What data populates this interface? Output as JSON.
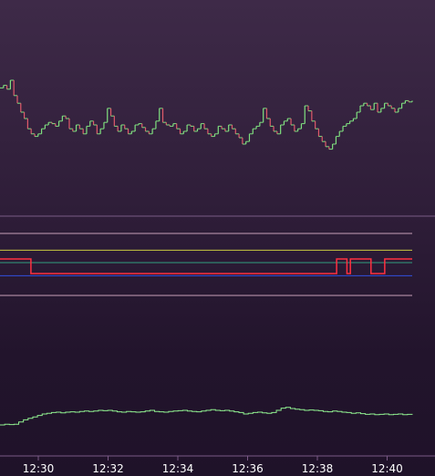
{
  "colors": {
    "up": "#7fe07f",
    "down": "#e05a6a",
    "neutral": "#c8b8d0",
    "signal": "#ff3040",
    "upper_band": "#c8c840",
    "middle_band": "#30a080",
    "lower_band": "#3050e0",
    "limit_lines": "#c8a0b8",
    "separator": "#7a5a86",
    "volume_line": "#90f090",
    "tick_text": "#ffffff"
  },
  "chart_data": [
    {
      "type": "line",
      "panel": "price",
      "title": "",
      "xlabel": "",
      "ylabel": "",
      "grid": false,
      "x_start": "12:29:20",
      "x_end": "12:40:35",
      "series": [
        {
          "values": [
            0.74,
            0.76,
            0.73,
            0.8,
            0.68,
            0.62,
            0.55,
            0.5,
            0.42,
            0.38,
            0.36,
            0.38,
            0.42,
            0.45,
            0.47,
            0.46,
            0.44,
            0.48,
            0.52,
            0.5,
            0.42,
            0.4,
            0.45,
            0.42,
            0.38,
            0.44,
            0.48,
            0.45,
            0.38,
            0.42,
            0.47,
            0.58,
            0.52,
            0.44,
            0.4,
            0.45,
            0.42,
            0.38,
            0.4,
            0.45,
            0.46,
            0.43,
            0.4,
            0.38,
            0.42,
            0.48,
            0.58,
            0.47,
            0.45,
            0.44,
            0.46,
            0.42,
            0.38,
            0.4,
            0.45,
            0.44,
            0.4,
            0.42,
            0.46,
            0.42,
            0.38,
            0.36,
            0.38,
            0.44,
            0.42,
            0.4,
            0.45,
            0.42,
            0.38,
            0.35,
            0.3,
            0.32,
            0.38,
            0.42,
            0.44,
            0.47,
            0.58,
            0.5,
            0.44,
            0.4,
            0.38,
            0.45,
            0.48,
            0.5,
            0.45,
            0.4,
            0.42,
            0.46,
            0.6,
            0.56,
            0.48,
            0.42,
            0.36,
            0.32,
            0.28,
            0.26,
            0.3,
            0.36,
            0.4,
            0.44,
            0.46,
            0.48,
            0.5,
            0.55,
            0.6,
            0.62,
            0.6,
            0.57,
            0.62,
            0.55,
            0.58,
            0.62,
            0.6,
            0.58,
            0.55,
            0.58,
            0.62,
            0.64,
            0.63,
            0.64
          ]
        }
      ]
    },
    {
      "type": "line",
      "panel": "indicator",
      "title": "",
      "grid": false,
      "ylim": [
        0,
        1
      ],
      "horizontal_levels": [
        {
          "role": "upper_limit",
          "value": 0.95
        },
        {
          "role": "upper_band",
          "value": 0.72
        },
        {
          "role": "middle_band",
          "value": 0.55
        },
        {
          "role": "lower_band",
          "value": 0.37
        },
        {
          "role": "lower_limit",
          "value": 0.1
        }
      ],
      "series": [
        {
          "values": [
            0.6,
            0.6,
            0.6,
            0.6,
            0.6,
            0.6,
            0.6,
            0.6,
            0.6,
            0.4,
            0.4,
            0.4,
            0.4,
            0.4,
            0.4,
            0.4,
            0.4,
            0.4,
            0.4,
            0.4,
            0.4,
            0.4,
            0.4,
            0.4,
            0.4,
            0.4,
            0.4,
            0.4,
            0.4,
            0.4,
            0.4,
            0.4,
            0.4,
            0.4,
            0.4,
            0.4,
            0.4,
            0.4,
            0.4,
            0.4,
            0.4,
            0.4,
            0.4,
            0.4,
            0.4,
            0.4,
            0.4,
            0.4,
            0.4,
            0.4,
            0.4,
            0.4,
            0.4,
            0.4,
            0.4,
            0.4,
            0.4,
            0.4,
            0.4,
            0.4,
            0.4,
            0.4,
            0.4,
            0.4,
            0.4,
            0.4,
            0.4,
            0.4,
            0.4,
            0.4,
            0.4,
            0.4,
            0.4,
            0.4,
            0.4,
            0.4,
            0.4,
            0.4,
            0.4,
            0.4,
            0.4,
            0.4,
            0.4,
            0.4,
            0.4,
            0.4,
            0.4,
            0.4,
            0.4,
            0.4,
            0.4,
            0.4,
            0.4,
            0.4,
            0.4,
            0.4,
            0.4,
            0.4,
            0.6,
            0.6,
            0.6,
            0.4,
            0.6,
            0.6,
            0.6,
            0.6,
            0.6,
            0.6,
            0.4,
            0.4,
            0.4,
            0.4,
            0.6,
            0.6,
            0.6,
            0.6,
            0.6,
            0.6,
            0.6,
            0.6,
            0.6
          ]
        }
      ]
    },
    {
      "type": "line",
      "panel": "volume",
      "title": "",
      "grid": false,
      "ylim": [
        0,
        1
      ],
      "series": [
        {
          "values": [
            0.1,
            0.12,
            0.11,
            0.12,
            0.18,
            0.24,
            0.28,
            0.32,
            0.36,
            0.4,
            0.42,
            0.44,
            0.45,
            0.43,
            0.45,
            0.46,
            0.45,
            0.47,
            0.48,
            0.47,
            0.48,
            0.5,
            0.49,
            0.5,
            0.48,
            0.46,
            0.45,
            0.47,
            0.46,
            0.45,
            0.46,
            0.48,
            0.5,
            0.47,
            0.46,
            0.45,
            0.47,
            0.48,
            0.49,
            0.5,
            0.48,
            0.47,
            0.46,
            0.48,
            0.5,
            0.52,
            0.5,
            0.49,
            0.5,
            0.48,
            0.46,
            0.44,
            0.4,
            0.42,
            0.44,
            0.45,
            0.43,
            0.42,
            0.44,
            0.5,
            0.56,
            0.58,
            0.55,
            0.53,
            0.52,
            0.5,
            0.51,
            0.5,
            0.49,
            0.47,
            0.46,
            0.48,
            0.47,
            0.45,
            0.44,
            0.42,
            0.43,
            0.41,
            0.39,
            0.4,
            0.38,
            0.39,
            0.4,
            0.38,
            0.39,
            0.4,
            0.38,
            0.39,
            0.38
          ]
        }
      ]
    }
  ],
  "time_axis": {
    "ticks": [
      "12:30",
      "12:32",
      "12:34",
      "12:36",
      "12:38",
      "12:40"
    ]
  }
}
